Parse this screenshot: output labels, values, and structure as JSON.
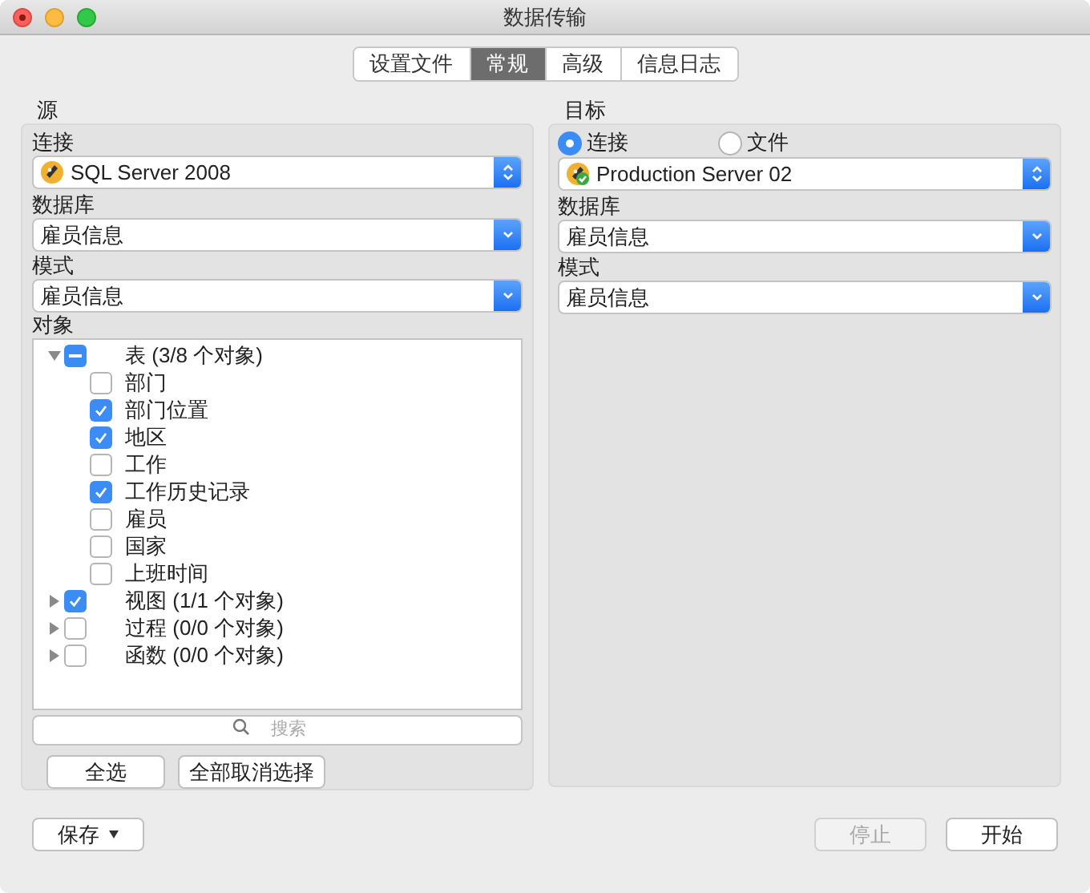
{
  "window": {
    "title": "数据传输"
  },
  "tabs": [
    {
      "label": "设置文件",
      "selected": false
    },
    {
      "label": "常规",
      "selected": true
    },
    {
      "label": "高级",
      "selected": false
    },
    {
      "label": "信息日志",
      "selected": false
    }
  ],
  "source": {
    "title": "源",
    "connection_label": "连接",
    "connection": "SQL Server 2008",
    "database_label": "数据库",
    "database": "雇员信息",
    "schema_label": "模式",
    "schema": "雇员信息",
    "objects_label": "对象",
    "tree": [
      {
        "label": "表 (3/8 个对象)",
        "checked": true,
        "mixed": true,
        "expanded": true,
        "children": [
          {
            "label": "部门",
            "checked": false
          },
          {
            "label": "部门位置",
            "checked": true
          },
          {
            "label": "地区",
            "checked": true
          },
          {
            "label": "工作",
            "checked": false
          },
          {
            "label": "工作历史记录",
            "checked": true
          },
          {
            "label": "雇员",
            "checked": false
          },
          {
            "label": "国家",
            "checked": false
          },
          {
            "label": "上班时间",
            "checked": false
          }
        ]
      },
      {
        "label": "视图 (1/1 个对象)",
        "checked": true,
        "mixed": false,
        "expanded": false
      },
      {
        "label": "过程 (0/0 个对象)",
        "checked": false,
        "mixed": false,
        "expanded": false
      },
      {
        "label": "函数 (0/0 个对象)",
        "checked": false,
        "mixed": false,
        "expanded": false
      }
    ],
    "search": {
      "placeholder": "搜索"
    },
    "buttons": [
      {
        "label": "全选",
        "disabled": false
      },
      {
        "label": "全部取消选择",
        "disabled": false
      }
    ]
  },
  "target": {
    "title": "目标",
    "modes": [
      {
        "label": "连接",
        "selected": true
      },
      {
        "label": "文件",
        "selected": false
      }
    ],
    "connection": "Production Server 02",
    "database_label": "数据库",
    "database": "雇员信息",
    "schema_label": "模式",
    "schema": "雇员信息"
  },
  "footer": {
    "save": {
      "label": "保存",
      "disabled": false
    },
    "buttons": [
      {
        "label": "停止",
        "disabled": true
      },
      {
        "label": "开始",
        "disabled": false
      }
    ]
  }
}
